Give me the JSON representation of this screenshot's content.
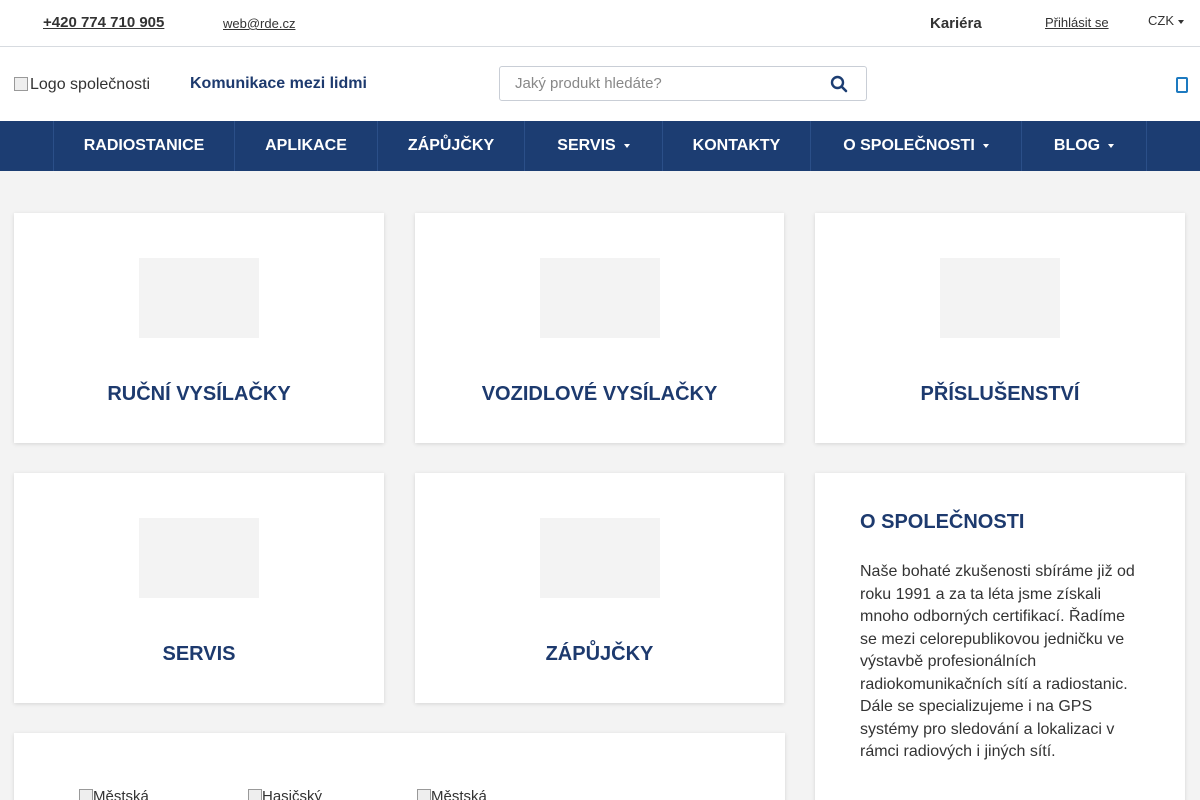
{
  "topbar": {
    "phone": "+420 774 710 905",
    "email": "web@rde.cz",
    "career": "Kariéra",
    "login": "Přihlásit se",
    "currency": "CZK"
  },
  "header": {
    "logo_alt": "Logo společnosti",
    "tagline": "Komunikace mezi lidmi",
    "search_placeholder": "Jaký produkt hledáte?"
  },
  "nav": {
    "items": [
      {
        "label": "RADIOSTANICE",
        "dropdown": false
      },
      {
        "label": "APLIKACE",
        "dropdown": false
      },
      {
        "label": "ZÁPŮJČKY",
        "dropdown": false
      },
      {
        "label": "SERVIS",
        "dropdown": true
      },
      {
        "label": "KONTAKTY",
        "dropdown": false
      },
      {
        "label": "O SPOLEČNOSTI",
        "dropdown": true
      },
      {
        "label": "BLOG",
        "dropdown": true
      }
    ]
  },
  "categories": [
    {
      "label": "RUČNÍ VYSÍLAČKY"
    },
    {
      "label": "VOZIDLOVÉ VYSÍLAČKY"
    },
    {
      "label": "PŘÍSLUŠENSTVÍ"
    },
    {
      "label": "SERVIS"
    },
    {
      "label": "ZÁPŮJČKY"
    }
  ],
  "about": {
    "title": "O SPOLEČNOSTI",
    "text": "Naše bohaté zkušenosti sbíráme již od roku 1991 a za ta léta jsme získali mnoho odborných certifikací. Řadíme se mezi celorepublikovou jedničku ve výstavbě profesionálních radiokomunikačních sítí a radiostanic. Dále se specializujeme i na GPS systémy pro sledování a lokalizaci v rámci radiových i jiných sítí."
  },
  "partners": [
    {
      "alt": "Městská"
    },
    {
      "alt": "Hasičský"
    },
    {
      "alt": "Městská"
    }
  ],
  "colors": {
    "brand": "#1c3d72",
    "heading": "#1d3a6e",
    "accent": "#1d7ac0"
  }
}
